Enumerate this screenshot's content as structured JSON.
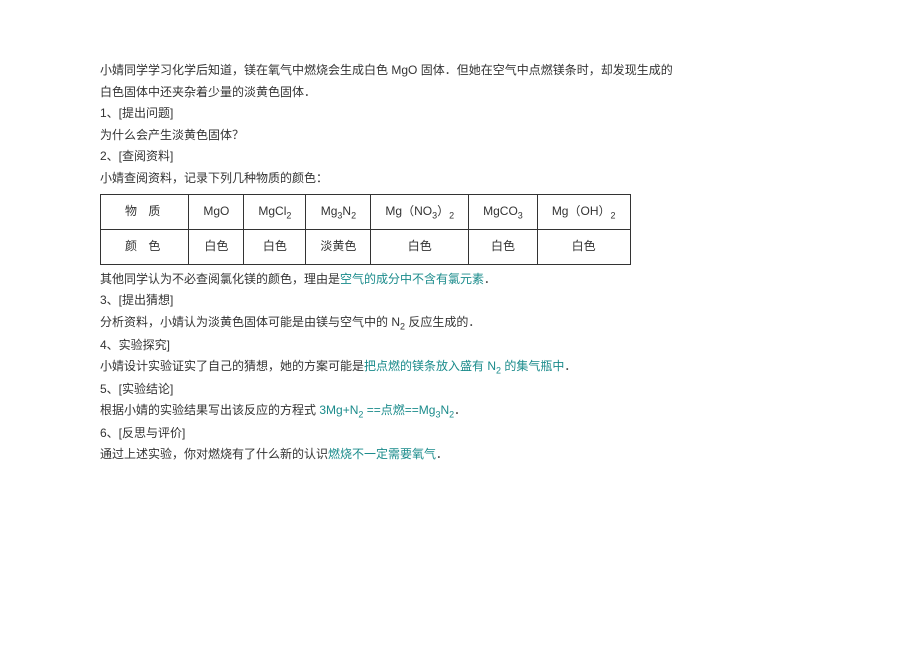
{
  "intro": {
    "line1_part1": "小婧同学学习化学后知道，镁在氧气中燃烧会生成白色 ",
    "line1_formula": "MgO",
    "line1_part2": " 固体．但她在空气中点燃镁条时，却发现生成的",
    "line2": "白色固体中还夹杂着少量的淡黄色固体．"
  },
  "section1": {
    "header": "1、[提出问题]",
    "body": "为什么会产生淡黄色固体？"
  },
  "section2": {
    "header": "2、[查阅资料]",
    "body": "小婧查阅资料，记录下列几种物质的颜色："
  },
  "table": {
    "row1": {
      "label": "物 质",
      "c1": "MgO",
      "c2": "MgCl",
      "c2_sub": "2",
      "c3": "Mg",
      "c3_sub1": "3",
      "c3_mid": "N",
      "c3_sub2": "2",
      "c4_pre": "Mg（NO",
      "c4_sub": "3",
      "c4_post": "）",
      "c4_sub2": "2",
      "c5": "MgCO",
      "c5_sub": "3",
      "c6_pre": "Mg（OH）",
      "c6_sub": "2"
    },
    "row2": {
      "label": "颜 色",
      "c1": "白色",
      "c2": "白色",
      "c3": "淡黄色",
      "c4": "白色",
      "c5": "白色",
      "c6": "白色"
    }
  },
  "after_table": {
    "text": "其他同学认为不必查阅氯化镁的颜色，理由是",
    "answer": "空气的成分中不含有氯元素",
    "period": "．"
  },
  "section3": {
    "header": "3、[提出猜想]",
    "body_part1": "分析资料，小婧认为淡黄色固体可能是由镁与空气中的 ",
    "body_formula": "N",
    "body_sub": "2",
    "body_part2": " 反应生成的．"
  },
  "section4": {
    "header": "4、实验探究]",
    "body_part1": "小婧设计实验证实了自己的猜想，她的方案可能是",
    "answer_part1": "把点燃的镁条放入盛有 N",
    "answer_sub": "2",
    "answer_part2": " 的集气瓶中",
    "period": "．"
  },
  "section5": {
    "header": "5、[实验结论]",
    "body": "根据小婧的实验结果写出该反应的方程式 ",
    "answer_part1": "3Mg+N",
    "answer_sub1": "2",
    "answer_mid": " ==点燃==Mg",
    "answer_sub2": "3",
    "answer_mid2": "N",
    "answer_sub3": "2",
    "period": "．"
  },
  "section6": {
    "header": "6、[反思与评价]",
    "body": "通过上述实验，你对燃烧有了什么新的认识",
    "answer": "燃烧不一定需要氧气",
    "period": "．"
  }
}
